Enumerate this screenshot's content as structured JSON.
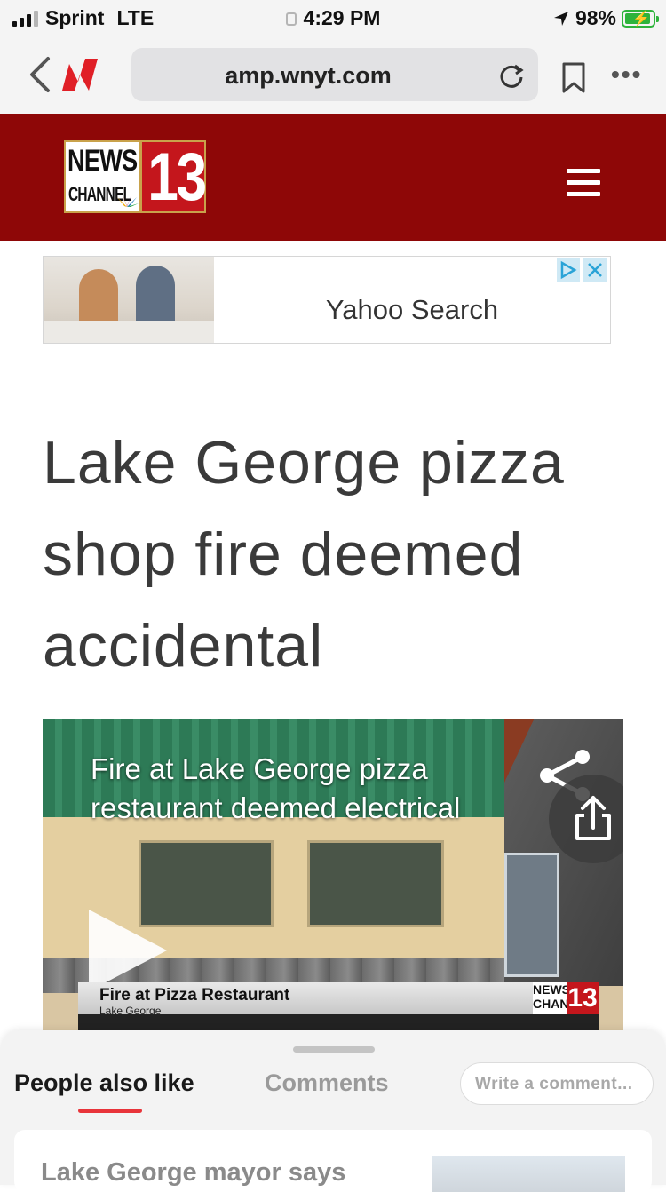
{
  "status_bar": {
    "carrier": "Sprint",
    "network": "LTE",
    "time": "4:29 PM",
    "battery_percent": "98%",
    "battery_level": 0.98,
    "signal_bars": 3,
    "signal_bars_total": 4
  },
  "browser": {
    "url": "amp.wnyt.com",
    "more_label": "•••"
  },
  "site_header": {
    "logo_word_top": "NEWS",
    "logo_word_bottom": "CHANNEL",
    "logo_number": "13",
    "brand_color": "#8e0707"
  },
  "ad": {
    "text": "Yahoo Search"
  },
  "article": {
    "headline": "Lake George pizza shop fire deemed accidental"
  },
  "video": {
    "title": "Fire at Lake George pizza restaurant deemed electrical",
    "lower_third_title": "Fire at Pizza Restaurant",
    "lower_third_subtitle": "Lake George",
    "minilogo_top": "NEWS CHANNEL",
    "minilogo_number": "13"
  },
  "bottom_sheet": {
    "tab_people": "People also like",
    "tab_comments": "Comments",
    "comment_placeholder": "Write a comment...",
    "card_title": "Lake George mayor says",
    "accent_color": "#e8343a"
  }
}
